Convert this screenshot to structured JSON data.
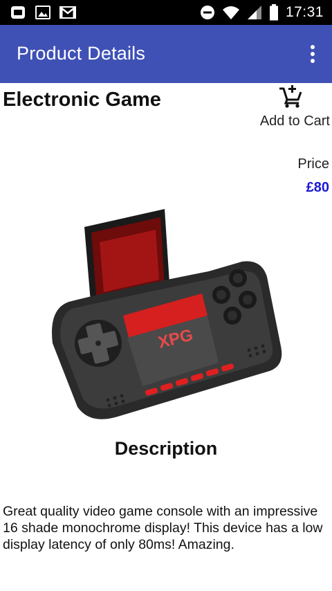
{
  "status_bar": {
    "time": "17:31",
    "icons": [
      "app-notification-icon",
      "image-icon",
      "gmail-icon",
      "do-not-disturb-icon",
      "wifi-icon",
      "signal-icon",
      "battery-icon"
    ]
  },
  "app_bar": {
    "title": "Product Details",
    "background": "#3F51B5",
    "overflow_icon": "more-vert-icon"
  },
  "product": {
    "name": "Electronic Game",
    "add_to_cart_label": "Add to Cart",
    "add_to_cart_icon": "add-shopping-cart-icon",
    "price_label": "Price",
    "price_value": "£80",
    "price_color": "#1a1ad6",
    "image_subject": "handheld-game-console",
    "description_heading": "Description",
    "description_text": "Great quality video game  console with an impressive 16 shade monochrome display! This device has a low display latency of only 80ms! Amazing."
  }
}
